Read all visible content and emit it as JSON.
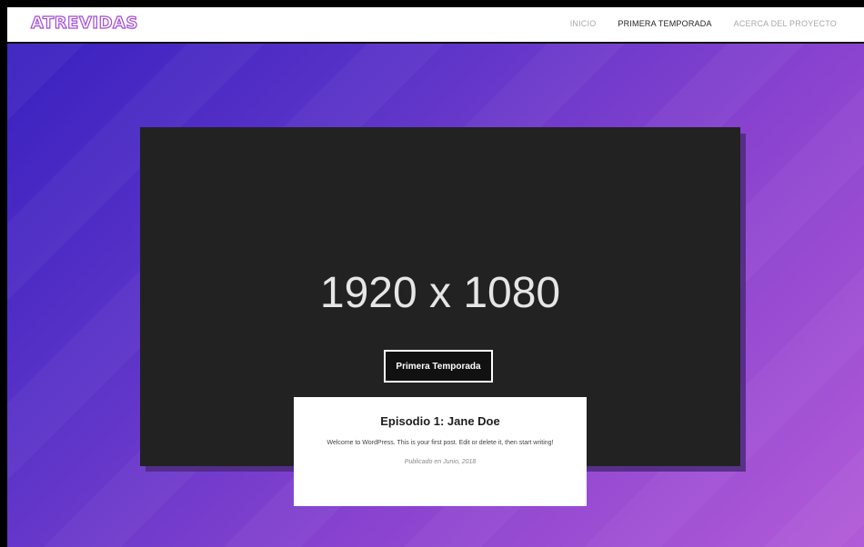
{
  "site": {
    "logo_text": "ATREVIDAS"
  },
  "nav": {
    "items": [
      {
        "label": "INICIO"
      },
      {
        "label": "PRIMERA TEMPORADA"
      },
      {
        "label": "ACERCA DEL PROYECTO"
      }
    ]
  },
  "hero": {
    "image_placeholder": "1920 x 1080",
    "button_label": "Primera Temporada"
  },
  "post": {
    "title": "Episodio 1: Jane Doe",
    "excerpt": "Welcome to WordPress. This is your first post. Edit or delete it, then start writing!",
    "meta": "Publicado en Junio, 2018"
  },
  "colors": {
    "accent": "#a34bd6",
    "gradient_start": "#3a21c0",
    "gradient_end": "#b25bd8"
  }
}
